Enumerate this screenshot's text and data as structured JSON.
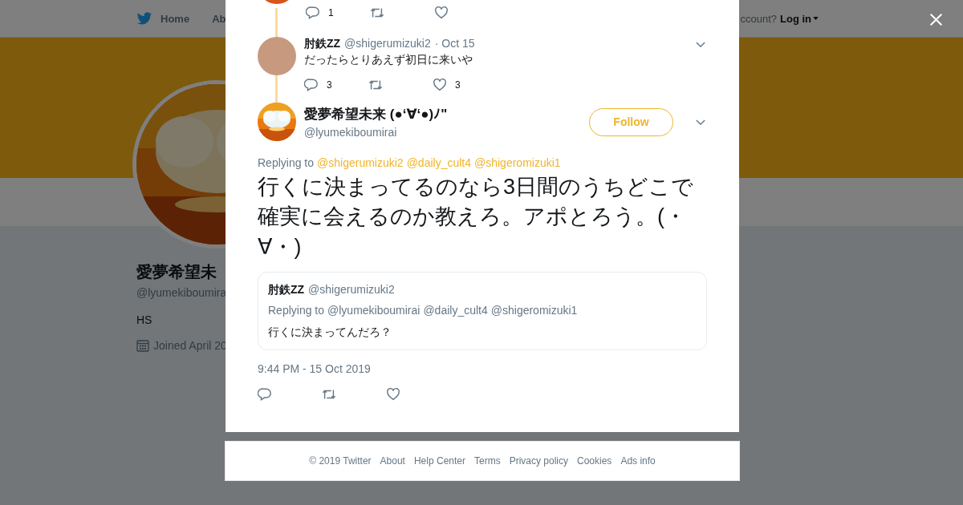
{
  "nav": {
    "items": [
      "Home",
      "Ab"
    ],
    "login_prompt": "ccount?",
    "login": "Log in"
  },
  "profile": {
    "name": "愛夢希望未",
    "handle": "@lyumekiboumira",
    "bio": "HS",
    "joined": "Joined April 20"
  },
  "modal": {
    "previous_actions": [
      {
        "kind": "reply",
        "count": "1"
      },
      {
        "kind": "retweet"
      },
      {
        "kind": "like"
      }
    ],
    "reply": {
      "name": "肘鉄ZZ",
      "handle": "@shigerumizuki2",
      "date": "· Oct 15",
      "text": "だったらとりあえず初日に来いや",
      "actions": [
        {
          "kind": "reply",
          "count": "3"
        },
        {
          "kind": "retweet"
        },
        {
          "kind": "like",
          "count": "3"
        }
      ]
    },
    "tweet": {
      "name": "愛夢希望未来 (●‘∀‘●)ﾉ\"",
      "handle": "@lyumekiboumirai",
      "follow": "Follow",
      "replying_label": "Replying to",
      "replying_to": [
        "@shigerumizuki2",
        "@daily_cult4",
        "@shigeromizuki1"
      ],
      "text": "行くに決まってるのなら3日間のうちどこで確実に会えるのか教えろ。アポとろう。(・∀・)",
      "quoted": {
        "name": "肘鉄ZZ",
        "handle": "@shigerumizuki2",
        "replying_label": "Replying to",
        "replying_to": [
          "@lyumekiboumirai",
          "@daily_cult4",
          "@shigeromizuki1"
        ],
        "text": "行くに決まってんだろ？"
      },
      "timestamp": "9:44 PM - 15 Oct 2019",
      "actions": [
        {
          "kind": "reply"
        },
        {
          "kind": "retweet"
        },
        {
          "kind": "like"
        }
      ]
    }
  },
  "footer": [
    "© 2019 Twitter",
    "About",
    "Help Center",
    "Terms",
    "Privacy policy",
    "Cookies",
    "Ads info"
  ]
}
